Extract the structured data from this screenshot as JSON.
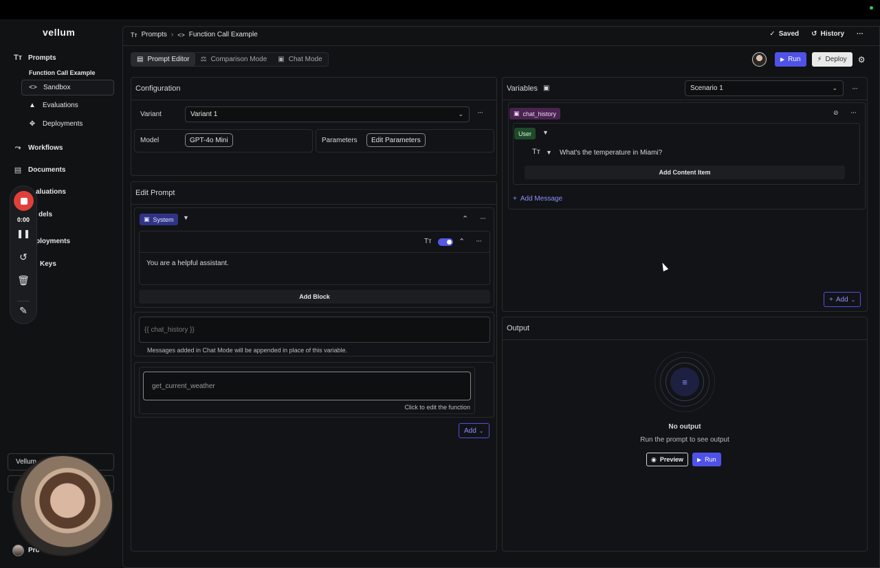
{
  "sidebar": {
    "logo": "vellum",
    "prompts_label": "Prompts",
    "current_prompt": "Function Call Example",
    "children": [
      {
        "label": "Sandbox",
        "icon": "code-icon",
        "active": true
      },
      {
        "label": "Evaluations",
        "icon": "flask-icon"
      },
      {
        "label": "Deployments",
        "icon": "deploy-icon"
      }
    ],
    "items": [
      {
        "label": "Workflows",
        "icon": "workflow-icon"
      },
      {
        "label": "Documents",
        "icon": "documents-icon"
      },
      {
        "label": "aluations",
        "icon": "evaluations-icon"
      },
      {
        "label": "dels",
        "icon": "models-icon"
      },
      {
        "label": "ployments",
        "icon": "deployments-icon"
      },
      {
        "label": "Keys",
        "icon": "keys-icon"
      }
    ],
    "org_label": "Vellum",
    "user_label": "Pro"
  },
  "recorder": {
    "time": "0:00"
  },
  "header": {
    "breadcrumb_root": "Prompts",
    "breadcrumb_current": "Function Call Example",
    "saved_label": "Saved",
    "history_label": "History"
  },
  "modes": {
    "prompt_editor": "Prompt Editor",
    "comparison": "Comparison Mode",
    "chat": "Chat Mode"
  },
  "toolbar": {
    "run_label": "Run",
    "deploy_label": "Deploy"
  },
  "configuration": {
    "title": "Configuration",
    "variant_label": "Variant",
    "variant_value": "Variant 1",
    "model_label": "Model",
    "model_value": "GPT-4o Mini",
    "parameters_label": "Parameters",
    "edit_parameters_label": "Edit Parameters"
  },
  "edit_prompt": {
    "title": "Edit Prompt",
    "system_tag": "System",
    "system_text": "You are a helpful assistant.",
    "add_block_label": "Add Block",
    "chat_history_placeholder": "{{ chat_history }}",
    "chat_history_note": "Messages added in Chat Mode will be appended in place of this variable.",
    "function_name": "get_current_weather",
    "function_hint": "Click to edit the function",
    "add_label": "Add"
  },
  "variables": {
    "title": "Variables",
    "scenario_value": "Scenario 1",
    "variable_tag": "chat_history",
    "role_tag": "User",
    "message_text": "What's the temperature in Miami?",
    "add_content_label": "Add Content Item",
    "add_message_label": "Add Message",
    "add_label": "Add"
  },
  "output": {
    "title": "Output",
    "empty_title": "No output",
    "empty_subtitle": "Run the prompt to see output",
    "preview_label": "Preview",
    "run_label": "Run"
  },
  "colors": {
    "accent": "#4f52e8",
    "system_tag": "#2f3486",
    "chat_tag": "#4a2350",
    "user_tag": "#1e4a2a",
    "record": "#e0403a"
  }
}
